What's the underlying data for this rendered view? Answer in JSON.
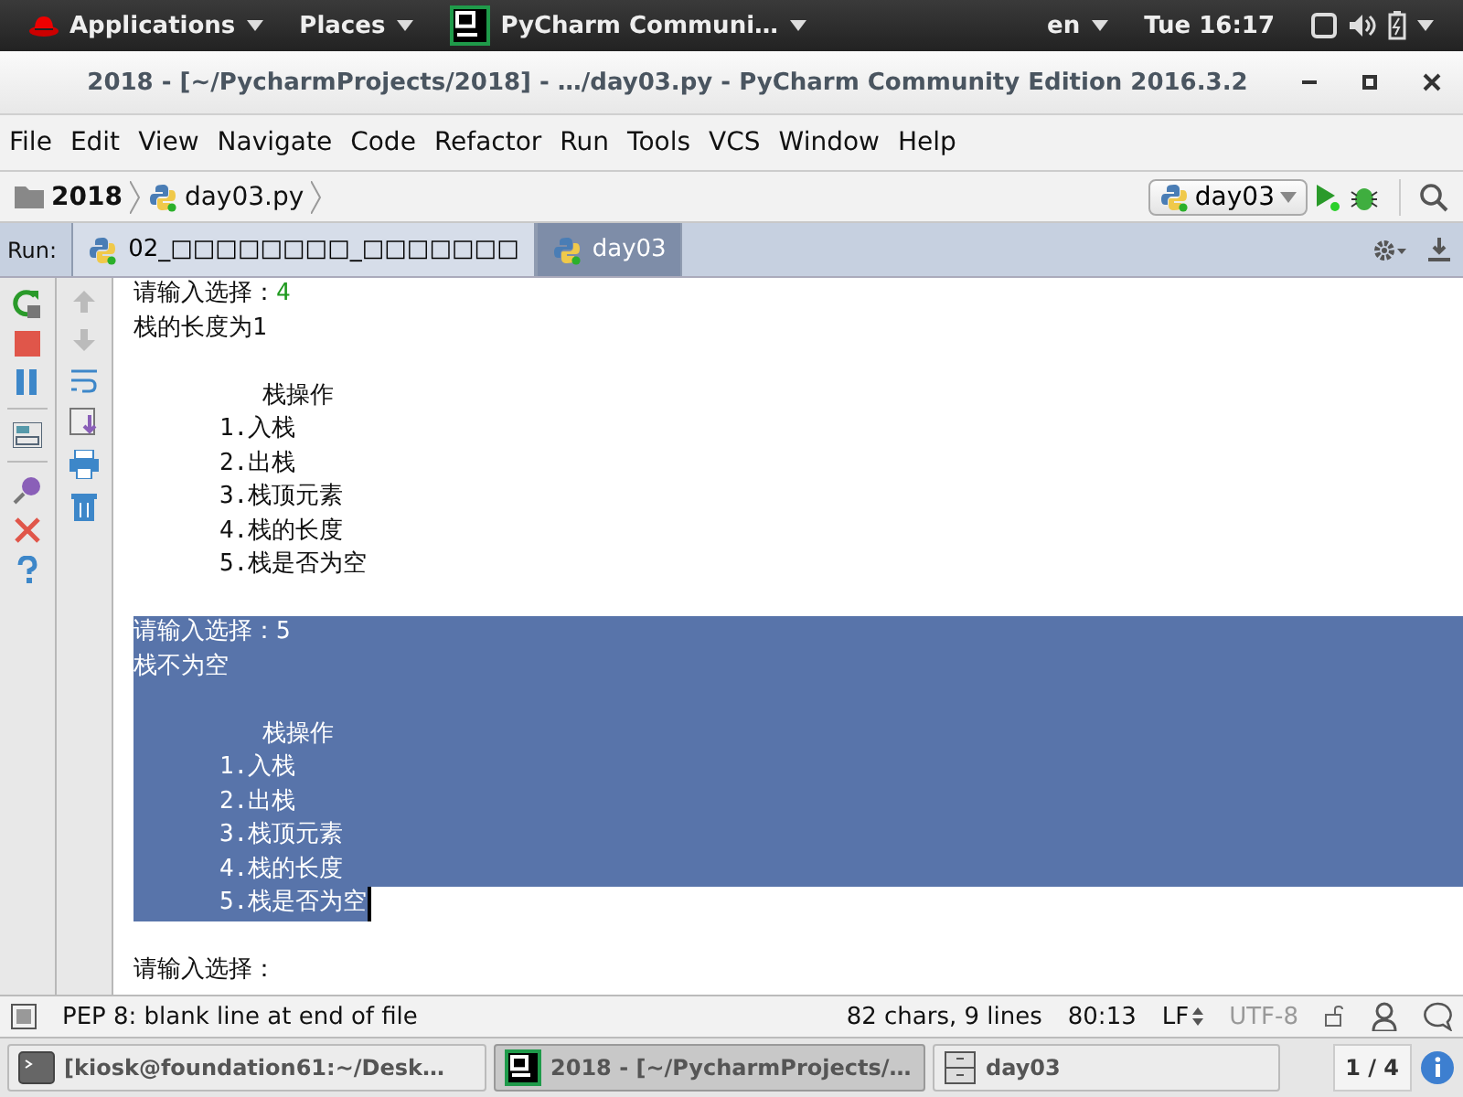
{
  "top_bar": {
    "applications": "Applications",
    "places": "Places",
    "active_app": "PyCharm Communi…",
    "keyboard": "en",
    "clock": "Tue 16:17"
  },
  "window": {
    "title": "2018 - [~/PycharmProjects/2018] - …/day03.py - PyCharm Community Edition 2016.3.2"
  },
  "menu": [
    "File",
    "Edit",
    "View",
    "Navigate",
    "Code",
    "Refactor",
    "Run",
    "Tools",
    "VCS",
    "Window",
    "Help"
  ],
  "navigation": {
    "breadcrumbs": [
      "2018",
      "day03.py"
    ],
    "run_config": "day03"
  },
  "run_panel": {
    "label": "Run:",
    "tabs": [
      {
        "label": "02_□□□□□□□□_□□□□□□□",
        "selected": false
      },
      {
        "label": "day03",
        "selected": true
      }
    ],
    "console": [
      {
        "text": "请输入选择：",
        "input": "4",
        "selected": false
      },
      {
        "text": "栈的长度为1",
        "selected": false
      },
      {
        "selected": false
      },
      {
        "text": "         栈操作",
        "selected": false
      },
      {
        "text": "      1.入栈",
        "selected": false
      },
      {
        "text": "      2.出栈",
        "selected": false
      },
      {
        "text": "      3.栈顶元素",
        "selected": false
      },
      {
        "text": "      4.栈的长度",
        "selected": false
      },
      {
        "text": "      5.栈是否为空",
        "selected": false
      },
      {
        "selected": false
      },
      {
        "text": "请输入选择：5",
        "selected": true
      },
      {
        "text": "栈不为空",
        "selected": true
      },
      {
        "selected": true
      },
      {
        "text": "         栈操作",
        "selected": true
      },
      {
        "text": "      1.入栈",
        "selected": true
      },
      {
        "text": "      2.出栈",
        "selected": true
      },
      {
        "text": "      3.栈顶元素",
        "selected": true
      },
      {
        "text": "      4.栈的长度",
        "selected": true
      },
      {
        "text": "      5.栈是否为空",
        "selected": true,
        "caret": true
      },
      {
        "selected": false
      },
      {
        "text": "请输入选择：",
        "selected": false
      }
    ]
  },
  "status_bar": {
    "message": "PEP 8: blank line at end of file",
    "stats": "82 chars, 9 lines",
    "position": "80:13",
    "line_separator": "LF",
    "encoding": "UTF-8"
  },
  "taskbar": {
    "items": [
      {
        "label": "[kiosk@foundation61:~/Desk…",
        "kind": "terminal",
        "selected": false
      },
      {
        "label": "2018 - [~/PycharmProjects/…",
        "kind": "ide",
        "selected": true
      },
      {
        "label": "day03",
        "kind": "files",
        "selected": false
      }
    ],
    "workspace": "1 / 4"
  }
}
